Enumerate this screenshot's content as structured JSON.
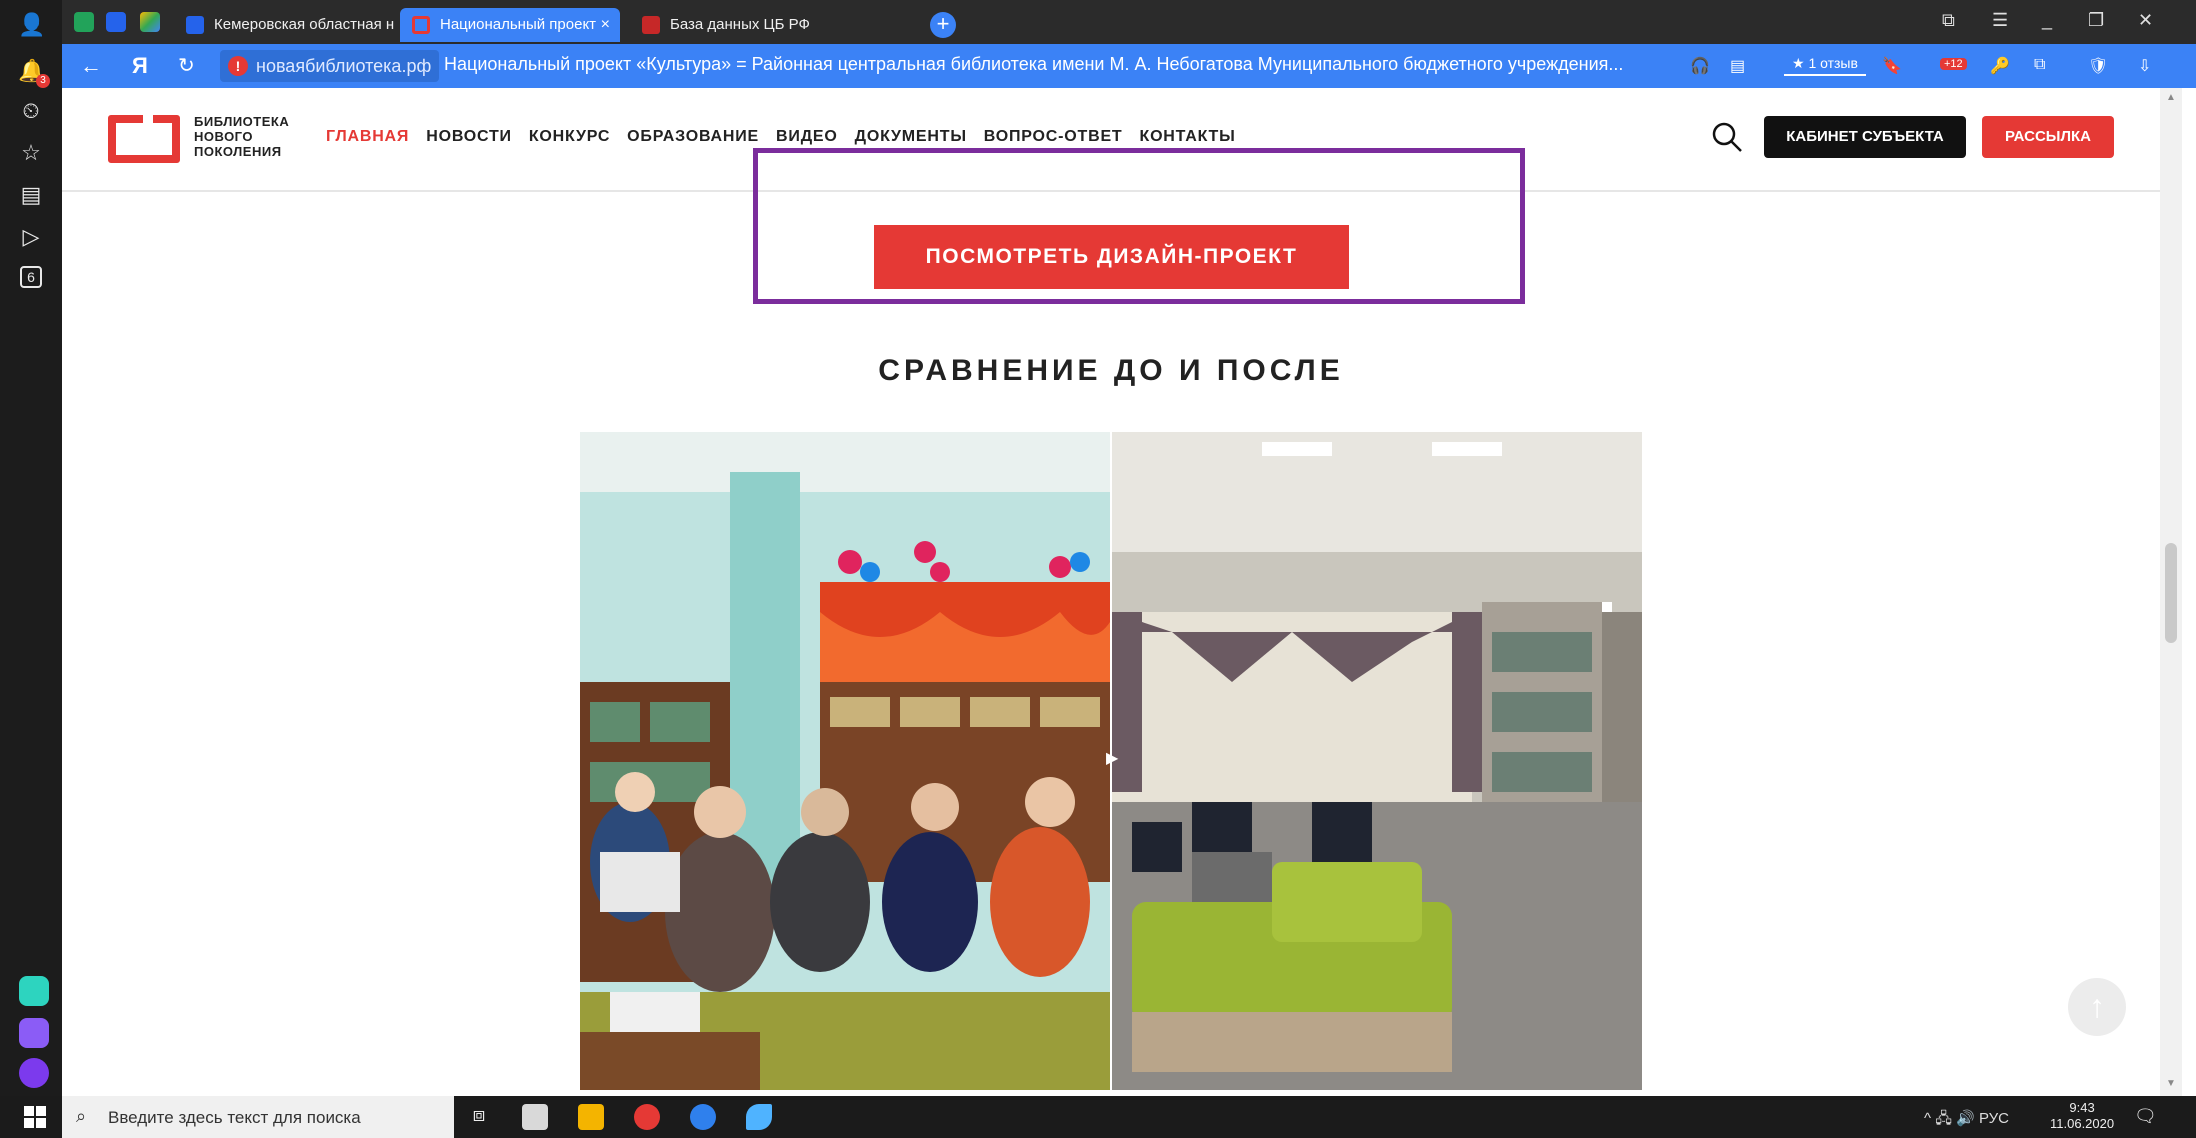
{
  "browser": {
    "tabs": [
      {
        "label": "Кемеровская областная н",
        "active": false
      },
      {
        "label": "Национальный проект",
        "active": true
      },
      {
        "label": "База данных ЦБ РФ",
        "active": false
      }
    ],
    "new_tab_label": "+",
    "url_host": "новаябиблиотека.рф",
    "page_title": "Национальный проект «Культура» = Районная центральная библиотека имени М. А. Небогатова Муниципального бюджетного учреждения...",
    "review_chip": "★ 1 отзыв",
    "extension_badge": "+12",
    "notification_count": "3",
    "sidebar_badge": "6"
  },
  "site": {
    "logo_text": "БИБЛИОТЕКА НОВОГО ПОКОЛЕНИЯ",
    "nav": [
      "ГЛАВНАЯ",
      "НОВОСТИ",
      "КОНКУРС",
      "ОБРАЗОВАНИЕ",
      "ВИДЕО",
      "ДОКУМЕНТЫ",
      "ВОПРОС-ОТВЕТ",
      "КОНТАКТЫ"
    ],
    "cabinet_button": "КАБИНЕТ СУБЪЕКТА",
    "mailing_button": "РАССЫЛКА",
    "design_button": "ПОСМОТРЕТЬ ДИЗАЙН-ПРОЕКТ",
    "compare_title": "СРАВНЕНИЕ ДО И ПОСЛЕ",
    "accent_color": "#e53935",
    "highlight_color": "#7b2d9c"
  },
  "taskbar": {
    "search_placeholder": "Введите здесь текст для поиска",
    "language": "РУС",
    "time": "9:43",
    "date": "11.06.2020"
  }
}
